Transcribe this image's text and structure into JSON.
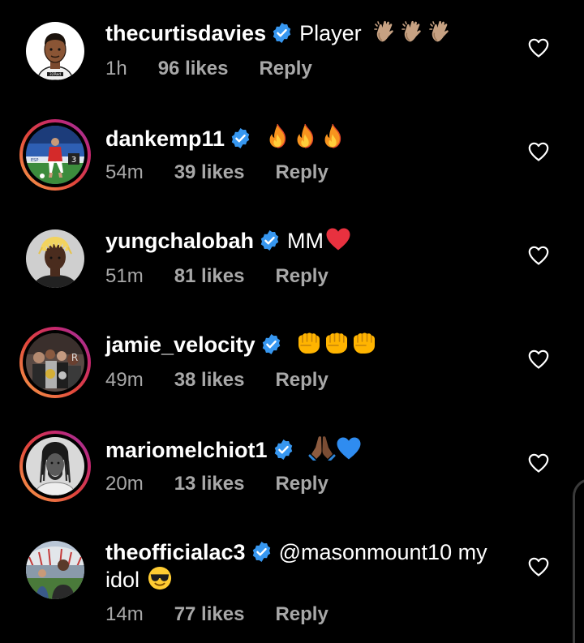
{
  "comments": [
    {
      "username": "thecurtisdavies",
      "text": "Player",
      "emoji": "clap-hands-x3",
      "time": "1h",
      "likes": "96 likes",
      "reply": "Reply"
    },
    {
      "username": "dankemp11",
      "text": "",
      "emoji": "fire-x3",
      "time": "54m",
      "likes": "39 likes",
      "reply": "Reply"
    },
    {
      "username": "yungchalobah",
      "text": "MM",
      "emoji": "red-heart",
      "time": "51m",
      "likes": "81 likes",
      "reply": "Reply"
    },
    {
      "username": "jamie_velocity",
      "text": "",
      "emoji": "fist-bump-x3",
      "time": "49m",
      "likes": "38 likes",
      "reply": "Reply"
    },
    {
      "username": "mariomelchiot1",
      "text": "",
      "emoji": "praying-hands-blue-heart",
      "time": "20m",
      "likes": "13 likes",
      "reply": "Reply"
    },
    {
      "username": "theofficialac3",
      "text": "@masonmount10 my idol",
      "emoji": "sunglasses-face",
      "time": "14m",
      "likes": "77 likes",
      "reply": "Reply"
    }
  ],
  "colors": {
    "background": "#000000",
    "meta_text": "#a8a8a8",
    "verified_badge": "#3797f0",
    "heart_outline": "#ffffff"
  }
}
